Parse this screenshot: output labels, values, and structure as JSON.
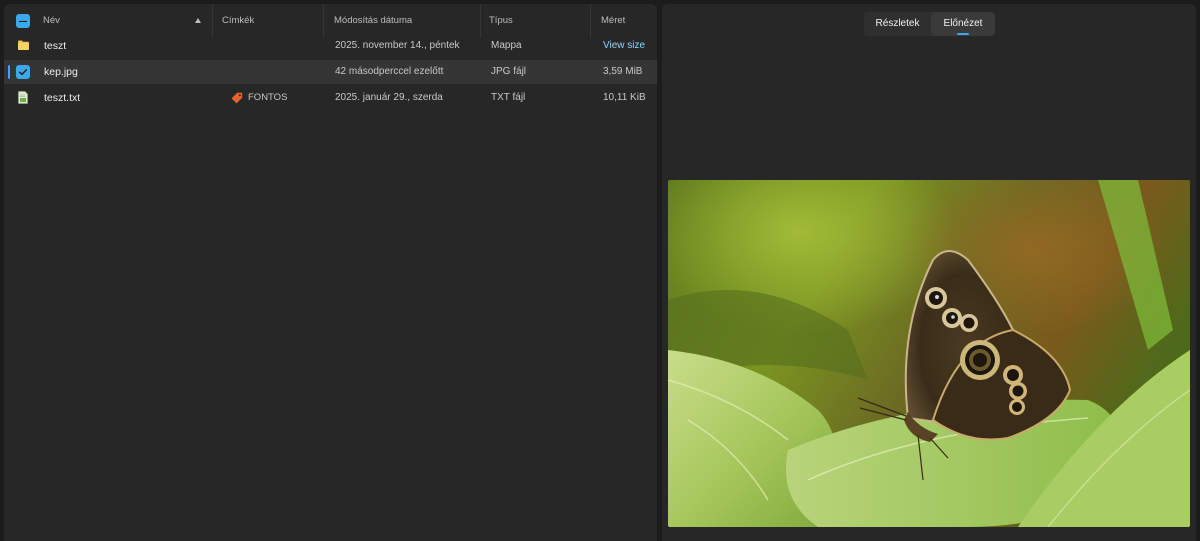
{
  "columns": {
    "name": "Név",
    "tags": "Címkék",
    "modified": "Módosítás dátuma",
    "type": "Típus",
    "size": "Méret"
  },
  "files": [
    {
      "name": "teszt",
      "tag": "",
      "modified": "2025. november 14., péntek",
      "type": "Mappa",
      "size": "View size",
      "kind": "folder-icon"
    },
    {
      "name": "kep.jpg",
      "tag": "",
      "modified": "42 másodperccel ezelőtt",
      "type": "JPG fájl",
      "size": "3,59 MiB",
      "kind": "checkbox-checked"
    },
    {
      "name": "teszt.txt",
      "tag": "FONTOS",
      "modified": "2025. január 29., szerda",
      "type": "TXT fájl",
      "size": "10,11 KiB",
      "kind": "text-file-icon"
    }
  ],
  "tag_color": "#e8612c",
  "accent": "#3da7e9",
  "details_tabs": [
    {
      "label": "Részletek",
      "active": false
    },
    {
      "label": "Előnézet",
      "active": true
    }
  ]
}
